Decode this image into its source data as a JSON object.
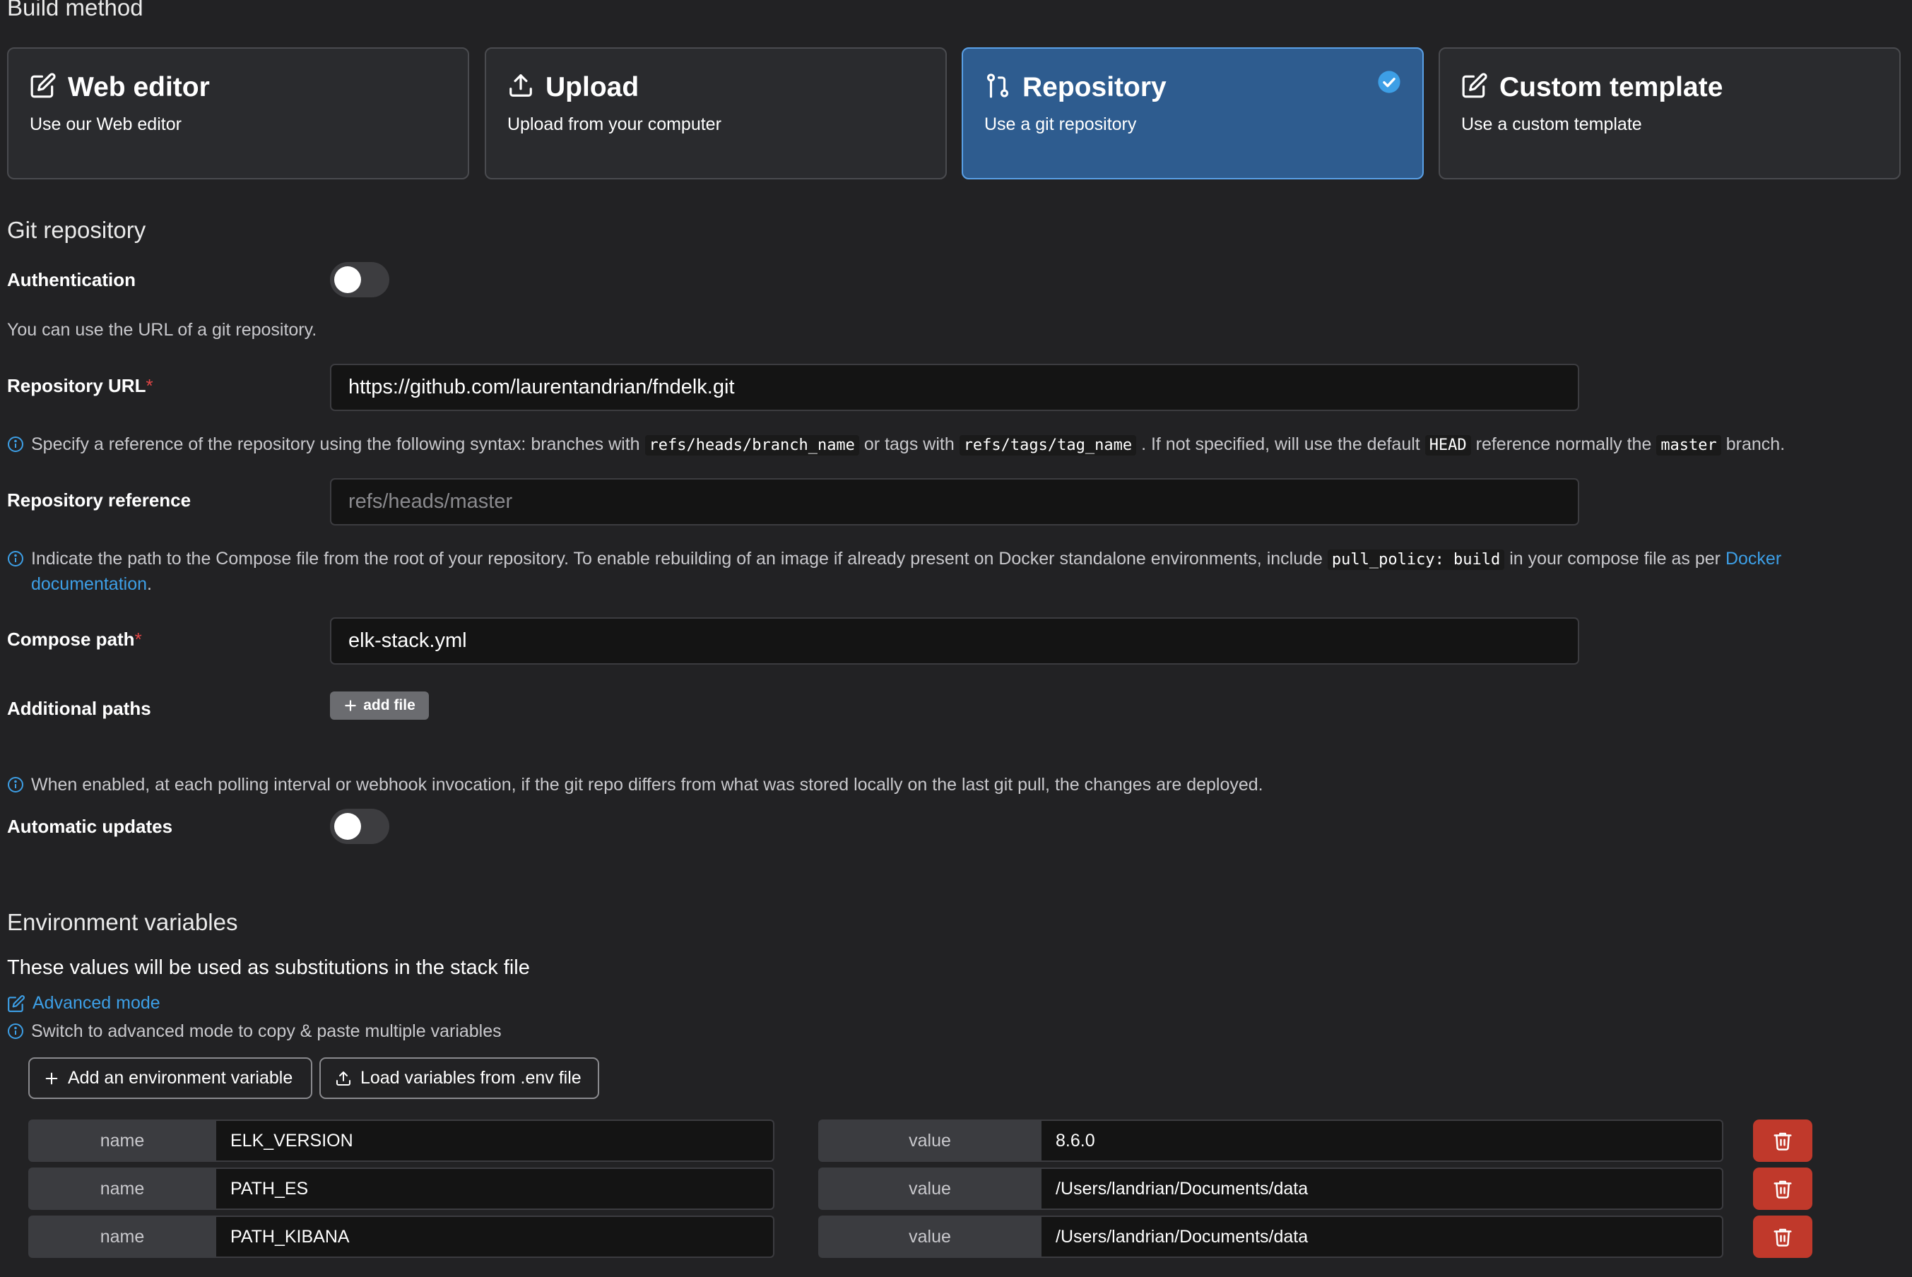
{
  "build_method": {
    "title": "Build method",
    "options": [
      {
        "title": "Web editor",
        "description": "Use our Web editor",
        "icon": "edit-icon",
        "selected": false
      },
      {
        "title": "Upload",
        "description": "Upload from your computer",
        "icon": "upload-icon",
        "selected": false
      },
      {
        "title": "Repository",
        "description": "Use a git repository",
        "icon": "git-icon",
        "selected": true
      },
      {
        "title": "Custom template",
        "description": "Use a custom template",
        "icon": "edit-icon",
        "selected": false
      }
    ]
  },
  "git_repository": {
    "title": "Git repository",
    "authentication_label": "Authentication",
    "authentication_enabled": false,
    "url_hint": "You can use the URL of a git repository.",
    "repository_url_label": "Repository URL",
    "repository_url_value": "https://github.com/laurentandrian/fndelk.git",
    "reference_help": {
      "part1": "Specify a reference of the repository using the following syntax: branches with",
      "code1": "refs/heads/branch_name",
      "part2": "or tags with",
      "code2": "refs/tags/tag_name",
      "part3": ". If not specified, will use the default",
      "code3": "HEAD",
      "part4": "reference normally the",
      "code4": "master",
      "part5": "branch."
    },
    "repository_reference_label": "Repository reference",
    "repository_reference_placeholder": "refs/heads/master",
    "compose_help": {
      "part1": "Indicate the path to the Compose file from the root of your repository. To enable rebuilding of an image if already present on Docker standalone environments, include",
      "code1": "pull_policy: build",
      "part2": "in your compose file as per",
      "link": "Docker documentation",
      "part3": "."
    },
    "compose_path_label": "Compose path",
    "compose_path_value": "elk-stack.yml",
    "additional_paths_label": "Additional paths",
    "add_file_label": "add file",
    "auto_update_help": "When enabled, at each polling interval or webhook invocation, if the git repo differs from what was stored locally on the last git pull, the changes are deployed.",
    "automatic_updates_label": "Automatic updates",
    "automatic_updates_enabled": false,
    "required_mark": "*"
  },
  "environment": {
    "title": "Environment variables",
    "subtitle": "These values will be used as substitutions in the stack file",
    "advanced_mode_label": "Advanced mode",
    "advanced_mode_hint": "Switch to advanced mode to copy & paste multiple variables",
    "add_variable_label": "Add an environment variable",
    "load_env_label": "Load variables from .env file",
    "name_label": "name",
    "value_label": "value",
    "variables": [
      {
        "name": "ELK_VERSION",
        "value": "8.6.0"
      },
      {
        "name": "PATH_ES",
        "value": "/Users/landrian/Documents/data"
      },
      {
        "name": "PATH_KIBANA",
        "value": "/Users/landrian/Documents/data"
      }
    ]
  },
  "colors": {
    "background": "#222224",
    "selected_card": "#2e5c8f",
    "accent": "#3d9fe6",
    "danger": "#c0392b"
  }
}
